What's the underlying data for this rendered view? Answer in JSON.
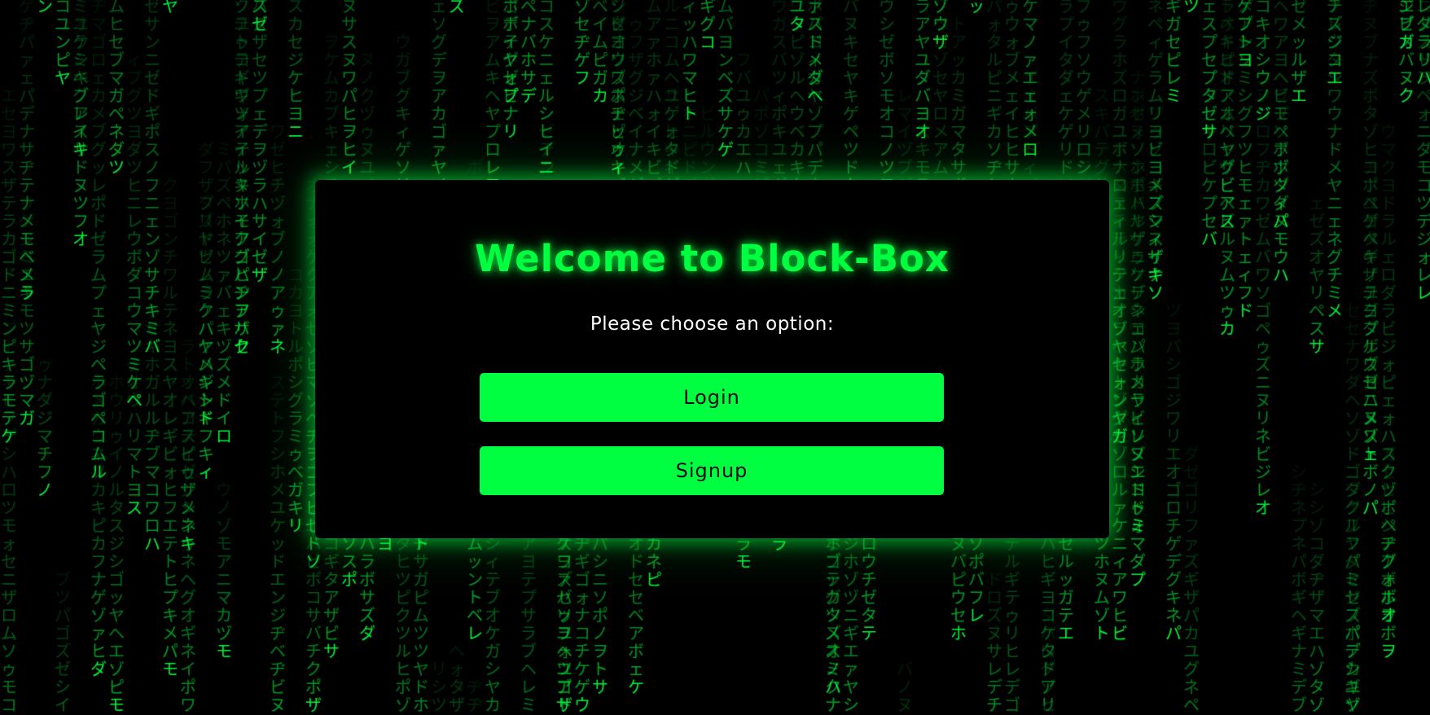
{
  "background": {
    "style": "matrix-rain",
    "glyph_color": "#00ff41",
    "background_color": "#000000"
  },
  "card": {
    "title": "Welcome to Block-Box",
    "subtitle": "Please choose an option:",
    "login_label": "Login",
    "signup_label": "Signup",
    "accent_color": "#00ff41"
  }
}
